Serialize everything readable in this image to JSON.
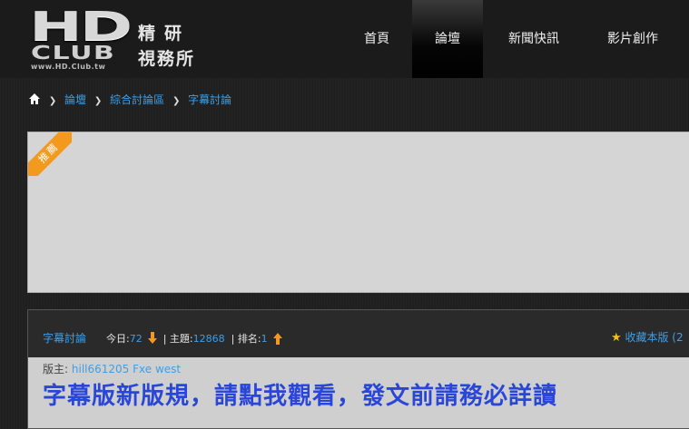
{
  "header": {
    "logo": {
      "hd": "HD",
      "club": "CLUB",
      "url": "www.HD.Club.tw",
      "cn_line1": "精研",
      "cn_line2": "視務所"
    },
    "nav": [
      {
        "label": "首頁"
      },
      {
        "label": "論壇",
        "active": true
      },
      {
        "label": "新聞快訊"
      },
      {
        "label": "影片創作"
      }
    ]
  },
  "breadcrumb": {
    "icon": "home-icon",
    "items": [
      "論壇",
      "綜合討論區",
      "字幕討論"
    ]
  },
  "ad": {
    "ribbon_label": "推薦"
  },
  "forum": {
    "title": "字幕討論",
    "today_label": "今日:",
    "today_value": "72",
    "topics_label": "| 主題:",
    "topics_value": "12868",
    "rank_label": "| 排名:",
    "rank_value": "1",
    "favorite_label": "收藏本版 (2",
    "moderators_label": "版主:",
    "moderators": "hill661205  Fxe  west",
    "notice": "字幕版新版規，請點我觀看，發文前請務必詳讀"
  },
  "colors": {
    "link": "#3d9fe8",
    "ribbon": "#f39a1e",
    "notice": "#2a46d8",
    "arrow": "#f39a1e"
  }
}
